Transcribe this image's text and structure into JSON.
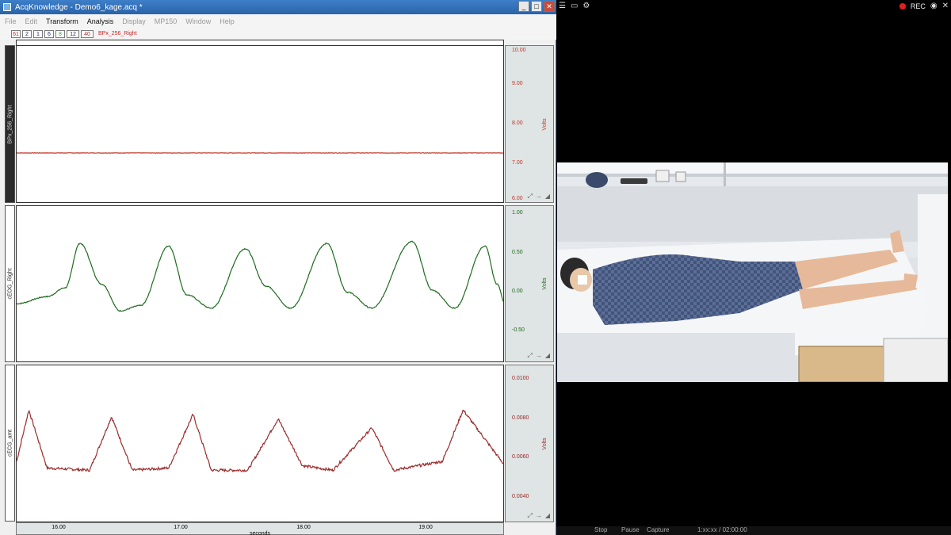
{
  "app": {
    "title": "AcqKnowledge - Demo6_kage.acq *",
    "min_btn": "_",
    "max_btn": "□",
    "close_btn": "✕"
  },
  "menu": [
    {
      "label": "File",
      "enabled": false
    },
    {
      "label": "Edit",
      "enabled": false
    },
    {
      "label": "Transform",
      "enabled": true
    },
    {
      "label": "Analysis",
      "enabled": true
    },
    {
      "label": "Display",
      "enabled": false
    },
    {
      "label": "MP150",
      "enabled": false
    },
    {
      "label": "Window",
      "enabled": false
    },
    {
      "label": "Help",
      "enabled": false
    }
  ],
  "toolbar": {
    "buttons": [
      "61",
      "2",
      "1",
      "6",
      "8",
      "12",
      "40"
    ],
    "active_channel": "BPx_256_Right"
  },
  "channels": [
    {
      "name": "BPx_256_Right",
      "unit": "Volts",
      "ticks": [
        "10.00",
        "9.00",
        "8.00",
        "7.00",
        "6.00"
      ],
      "color": "#c0392b",
      "ylim": [
        6.0,
        10.0
      ]
    },
    {
      "name": "cEOG_Right",
      "unit": "Volts",
      "ticks": [
        "1.00",
        "0.50",
        "0.00",
        "-0.50"
      ],
      "color": "#1e6b1e",
      "ylim": [
        -0.75,
        1.0
      ]
    },
    {
      "name": "cECG_amt",
      "unit": "Volts",
      "ticks": [
        "0.0100",
        "0.0080",
        "0.0060",
        "0.0040"
      ],
      "color": "#9b2a2a",
      "ylim": [
        0.0035,
        0.0105
      ]
    }
  ],
  "xaxis": {
    "ticks": [
      "16.00",
      "17.00",
      "18.00",
      "19.00"
    ],
    "unit": "seconds"
  },
  "video": {
    "rec_label": "REC",
    "controls": [
      "Stop",
      "Pause",
      "Capture"
    ],
    "timecode": "1:xx:xx / 02:00:00"
  },
  "chart_data": [
    {
      "type": "line",
      "series": [
        {
          "name": "BPx_256_Right",
          "values": [
            7.26,
            7.26,
            7.26,
            7.26
          ]
        }
      ],
      "x": [
        15.7,
        16.9,
        18.1,
        19.6
      ],
      "ylabel": "Volts",
      "ylim": [
        6.0,
        10.0
      ]
    },
    {
      "type": "line",
      "series": [
        {
          "name": "cEOG_Right",
          "values": [
            -0.1,
            -0.02,
            0.08,
            0.58,
            0.12,
            -0.18,
            -0.12,
            0.55,
            0.0,
            -0.15,
            0.52,
            0.1,
            -0.15,
            0.58,
            0.03,
            -0.15,
            0.6,
            0.05,
            -0.15,
            0.55,
            0.12,
            -0.12
          ]
        }
      ],
      "x": [
        15.7,
        15.95,
        16.1,
        16.22,
        16.4,
        16.55,
        16.72,
        16.95,
        17.1,
        17.3,
        17.58,
        17.75,
        17.95,
        18.25,
        18.42,
        18.62,
        18.95,
        19.12,
        19.3,
        19.55,
        19.65,
        19.72
      ],
      "ylabel": "Volts",
      "ylim": [
        -0.75,
        1.0
      ]
    },
    {
      "type": "line",
      "series": [
        {
          "name": "cECG_amt",
          "values": [
            0.0062,
            0.0085,
            0.0059,
            0.0058,
            0.0082,
            0.0058,
            0.0059,
            0.0083,
            0.0058,
            0.0058,
            0.0081,
            0.006,
            0.0058,
            0.0077,
            0.0058,
            0.0062,
            0.0085,
            0.0061
          ]
        }
      ],
      "x": [
        15.7,
        15.8,
        15.95,
        16.3,
        16.48,
        16.65,
        16.95,
        17.15,
        17.3,
        17.6,
        17.85,
        18.05,
        18.3,
        18.62,
        18.8,
        19.2,
        19.37,
        19.7
      ],
      "xlabel": "seconds",
      "ylabel": "Volts",
      "ylim": [
        0.0035,
        0.0105
      ]
    }
  ]
}
